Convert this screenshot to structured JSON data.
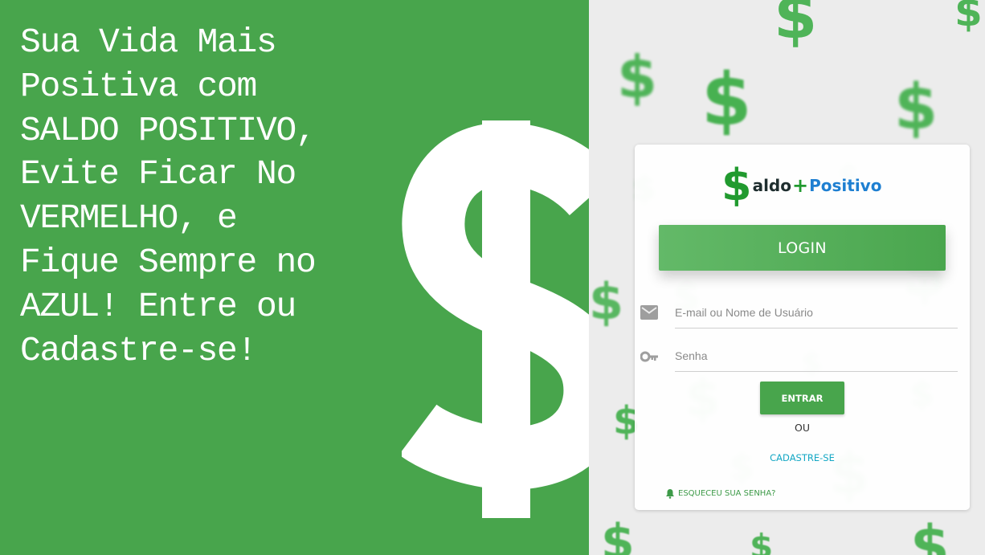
{
  "hero": {
    "text": "Sua Vida Mais\nPositiva com\nSALDO POSITIVO,\nEvite Ficar No\nVERMELHO, e\nFique Sempre no\nAZUL! Entre ou\nCadastre-se!"
  },
  "icons": {
    "big_dollar": "dollar-sign-icon",
    "email": "mail-icon",
    "password": "key-icon",
    "forgot": "bell-icon"
  },
  "colors": {
    "primary_green": "#48a54c",
    "logo_green": "#219a2f",
    "logo_blue": "#1e7fd1",
    "link_cyan": "#13a7c4",
    "background": "#ececec"
  },
  "logo": {
    "symbol": "$",
    "part1": "aldo",
    "plus": "+",
    "part2": "Positivo"
  },
  "login_header": "LOGIN",
  "form": {
    "email_placeholder": "E-mail ou Nome de Usuário",
    "password_placeholder": "Senha",
    "submit_label": "ENTRAR",
    "or_label": "OU",
    "signup_label": "CADASTRE-SE",
    "forgot_label": "ESQUECEU SUA SENHA?"
  },
  "background_symbol": "$"
}
